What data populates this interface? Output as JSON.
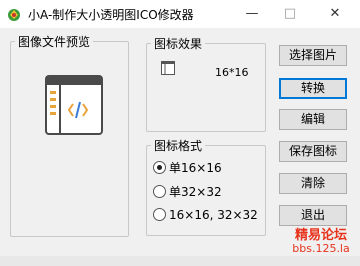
{
  "window": {
    "title": "小A-制作大小透明图ICO修改器",
    "minimize": "—",
    "maximize": "□",
    "close": "✕"
  },
  "preview_group": {
    "label": "图像文件预览"
  },
  "effect_group": {
    "label": "图标效果",
    "size_text": "16*16"
  },
  "format_group": {
    "label": "图标格式",
    "options": [
      {
        "label": "单16×16",
        "selected": true
      },
      {
        "label": "单32×32",
        "selected": false
      },
      {
        "label": "16×16, 32×32",
        "selected": false
      }
    ]
  },
  "buttons": {
    "select_image": "选择图片",
    "convert": "转换",
    "edit": "编辑",
    "save_icon": "保存图标",
    "clear": "清除",
    "exit": "退出"
  },
  "watermark": {
    "line1": "精易论坛",
    "line2": "bbs.125.la"
  },
  "colors": {
    "accent": "#0078d7",
    "watermark": "#e8331c",
    "preview_accent": "#e8a33a"
  }
}
